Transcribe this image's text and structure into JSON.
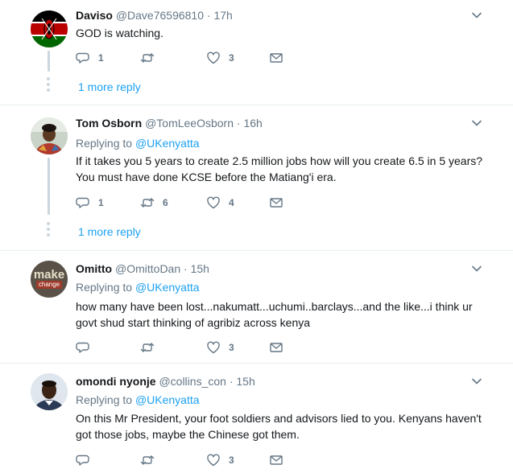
{
  "tweets": [
    {
      "name": "Daviso",
      "handle": "@Dave76596810",
      "sep": "·",
      "time": "17h",
      "text": "GOD is watching.",
      "replies": "1",
      "retweets": "",
      "likes": "3",
      "more_replies": "1 more reply"
    },
    {
      "name": "Tom Osborn",
      "handle": "@TomLeeOsborn",
      "sep": "·",
      "time": "16h",
      "replying_label": "Replying to",
      "replying_to": "@UKenyatta",
      "text": "If it takes you 5 years to create 2.5 million jobs how will you create 6.5 in 5 years? You must have done KCSE before the Matiang'i era.",
      "replies": "1",
      "retweets": "6",
      "likes": "4",
      "more_replies": "1 more reply"
    },
    {
      "name": "Omitto",
      "handle": "@OmittoDan",
      "sep": "·",
      "time": "15h",
      "replying_label": "Replying to",
      "replying_to": "@UKenyatta",
      "text": "how many have been lost...nakumatt...uchumi..barclays...and the like...i think ur govt shud start thinking of agribiz across kenya",
      "replies": "",
      "retweets": "",
      "likes": "3",
      "avatar_text_1": "make",
      "avatar_text_2": "change"
    },
    {
      "name": "omondi nyonje",
      "handle": "@collins_con",
      "sep": "·",
      "time": "15h",
      "replying_label": "Replying to",
      "replying_to": "@UKenyatta",
      "text": "On this Mr President, your foot soldiers  and advisors lied to you. Kenyans haven't got those jobs, maybe the Chinese  got them.",
      "replies": "",
      "retweets": "",
      "likes": "3"
    }
  ],
  "colors": {
    "accent": "#1da1f2",
    "secondary_text": "#657786",
    "divider": "#e6ecf0"
  }
}
